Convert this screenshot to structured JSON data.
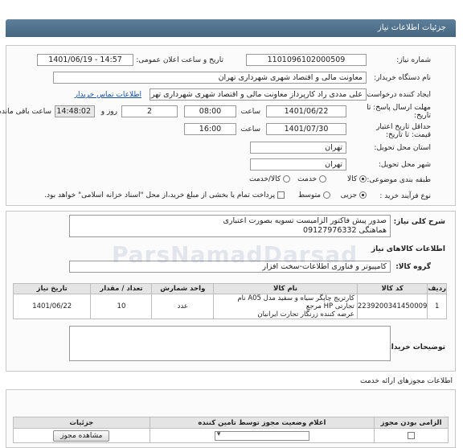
{
  "header": {
    "title": "جزئیات اطلاعات نیاز"
  },
  "need": {
    "number_label": "شماره نیاز:",
    "number": "1101096102000509",
    "announce_label": "تاریخ و ساعت اعلان عمومی:",
    "announce": "1401/06/19 - 14:57",
    "buyer_label": "نام دستگاه خریدار:",
    "buyer": "معاونت مالی و اقتصاد شهری شهرداری تهران",
    "creator_label": "ایجاد کننده درخواست:",
    "creator": "علی مددی راد کارپرداز معاونت مالی و اقتصاد شهری شهرداری تهران",
    "contact_link": "اطلاعات تماس خریدار",
    "deadline_label": "مهلت ارسال پاسخ: تا تاریخ:",
    "deadline_date": "1401/06/22",
    "time_label": "ساعت",
    "deadline_time": "08:00",
    "days": "2",
    "days_label": "روز و",
    "remain_time": "14:48:02",
    "remain_label": "ساعت باقی مانده",
    "min_validity_label": "حداقل تاریخ اعتبار قیمت: تا تاریخ:",
    "validity_date": "1401/07/30",
    "validity_time": "16:00",
    "province_label": "استان محل تحویل:",
    "province": "تهران",
    "city_label": "شهر محل تحویل:",
    "city": "تهران",
    "category_label": "طبقه بندی موضوعی:",
    "category_options": [
      "کالا",
      "خدمت",
      "کالا/خدمت"
    ],
    "process_label": "نوع فرآیند خرید :",
    "process_options": [
      "جزیی",
      "متوسط"
    ],
    "payment_note": "پرداخت تمام یا بخشی از مبلغ خرید،از محل \"اسناد خزانه اسلامی\" خواهد بود."
  },
  "summary": {
    "label": "شرح کلی نیاز:",
    "line1": "صدور پیش فاکتور الزامیست تسویه بصورت اعتباری",
    "line2": "هماهنگی 09127976332"
  },
  "goods": {
    "title": "اطلاعات کالاهای نیاز",
    "group_label": "گروه کالا:",
    "group": "کامپیوتر و فناوری اطلاعات-سخت افزار",
    "columns": [
      "ردیف",
      "کد کالا",
      "نام کالا",
      "واحد شمارش",
      "تعداد / مقدار",
      "تاریخ نیاز"
    ],
    "rows": [
      {
        "row": "1",
        "code": "2239200341450009",
        "name_line1": "کارتریج چاپگر سیاه و سفید مدل A05 نام تجارتی HP مرجع",
        "name_line2": "عرضه کننده زرنگار تجارت ایرانیان",
        "unit": "عدد",
        "qty": "10",
        "date": "1401/06/22"
      }
    ]
  },
  "notes": {
    "label": "توضیحات خریدار:"
  },
  "licenses": {
    "title": "اطلاعات مجوزهای ارائه خدمت",
    "columns": [
      "الزامی بودن مجوز",
      "اعلام وضعیت مجوز توسط تامین کننده",
      "جزئیات"
    ],
    "view_button": "مشاهده مجوز"
  },
  "watermark": "ParsNamadDarsad"
}
